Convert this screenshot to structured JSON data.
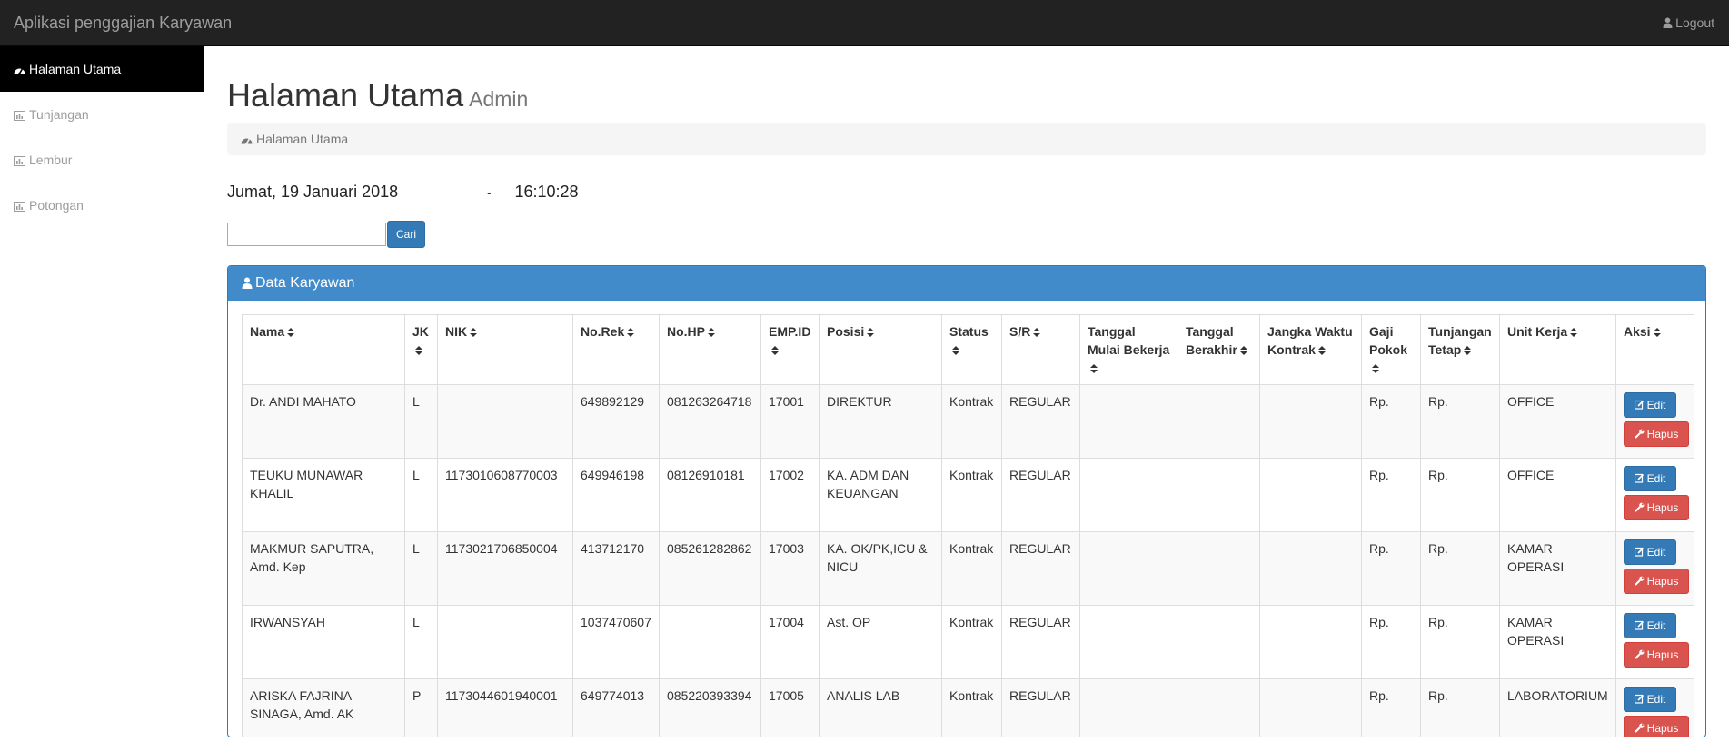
{
  "app": {
    "title": "Aplikasi penggajian Karyawan",
    "logout_label": "Logout"
  },
  "sidebar": {
    "items": [
      {
        "label": "Halaman Utama",
        "icon": "dashboard-icon",
        "active": true
      },
      {
        "label": "Tunjangan",
        "icon": "bar-chart-icon",
        "active": false
      },
      {
        "label": "Lembur",
        "icon": "bar-chart-icon",
        "active": false
      },
      {
        "label": "Potongan",
        "icon": "bar-chart-icon",
        "active": false
      }
    ]
  },
  "header": {
    "title": "Halaman Utama",
    "subtitle": "Admin"
  },
  "breadcrumb": {
    "label": "Halaman Utama"
  },
  "datetime": {
    "date": "Jumat, 19 Januari 2018",
    "separator": "-",
    "time": "16:10:28"
  },
  "search": {
    "value": "",
    "placeholder": "",
    "button_label": "Cari"
  },
  "panel": {
    "title": "Data Karyawan"
  },
  "table": {
    "columns": [
      "Nama",
      "JK",
      "NIK",
      "No.Rek",
      "No.HP",
      "EMP.ID",
      "Posisi",
      "Status",
      "S/R",
      "Tanggal Mulai Bekerja",
      "Tanggal Berakhir",
      "Jangka Waktu Kontrak",
      "Gaji Pokok",
      "Tunjangan Tetap",
      "Unit Kerja",
      "Aksi"
    ],
    "edit_label": "Edit",
    "delete_label": "Hapus",
    "rows": [
      [
        "Dr. ANDI MAHATO",
        "L",
        "",
        "649892129",
        "081263264718",
        "17001",
        "DIREKTUR",
        "Kontrak",
        "REGULAR",
        "",
        "",
        "",
        "Rp.",
        "Rp.",
        "OFFICE"
      ],
      [
        "TEUKU MUNAWAR KHALIL",
        "L",
        "1173010608770003",
        "649946198",
        "08126910181",
        "17002",
        "KA. ADM DAN KEUANGAN",
        "Kontrak",
        "REGULAR",
        "",
        "",
        "",
        "Rp.",
        "Rp.",
        "OFFICE"
      ],
      [
        "MAKMUR SAPUTRA, Amd. Kep",
        "L",
        "1173021706850004",
        "413712170",
        "085261282862",
        "17003",
        "KA. OK/PK,ICU & NICU",
        "Kontrak",
        "REGULAR",
        "",
        "",
        "",
        "Rp.",
        "Rp.",
        "KAMAR OPERASI"
      ],
      [
        "IRWANSYAH",
        "L",
        "",
        "1037470607",
        "",
        "17004",
        "Ast. OP",
        "Kontrak",
        "REGULAR",
        "",
        "",
        "",
        "Rp.",
        "Rp.",
        "KAMAR OPERASI"
      ],
      [
        "ARISKA FAJRINA SINAGA, Amd. AK",
        "P",
        "1173044601940001",
        "649774013",
        "085220393394",
        "17005",
        "ANALIS LAB",
        "Kontrak",
        "REGULAR",
        "",
        "",
        "",
        "Rp.",
        "Rp.",
        "LABORATORIUM"
      ]
    ]
  },
  "colors": {
    "topbar": "#222222",
    "panel_heading": "#428bca",
    "primary": "#337ab7",
    "danger": "#d9534f",
    "sidebar_active": "#000000"
  }
}
